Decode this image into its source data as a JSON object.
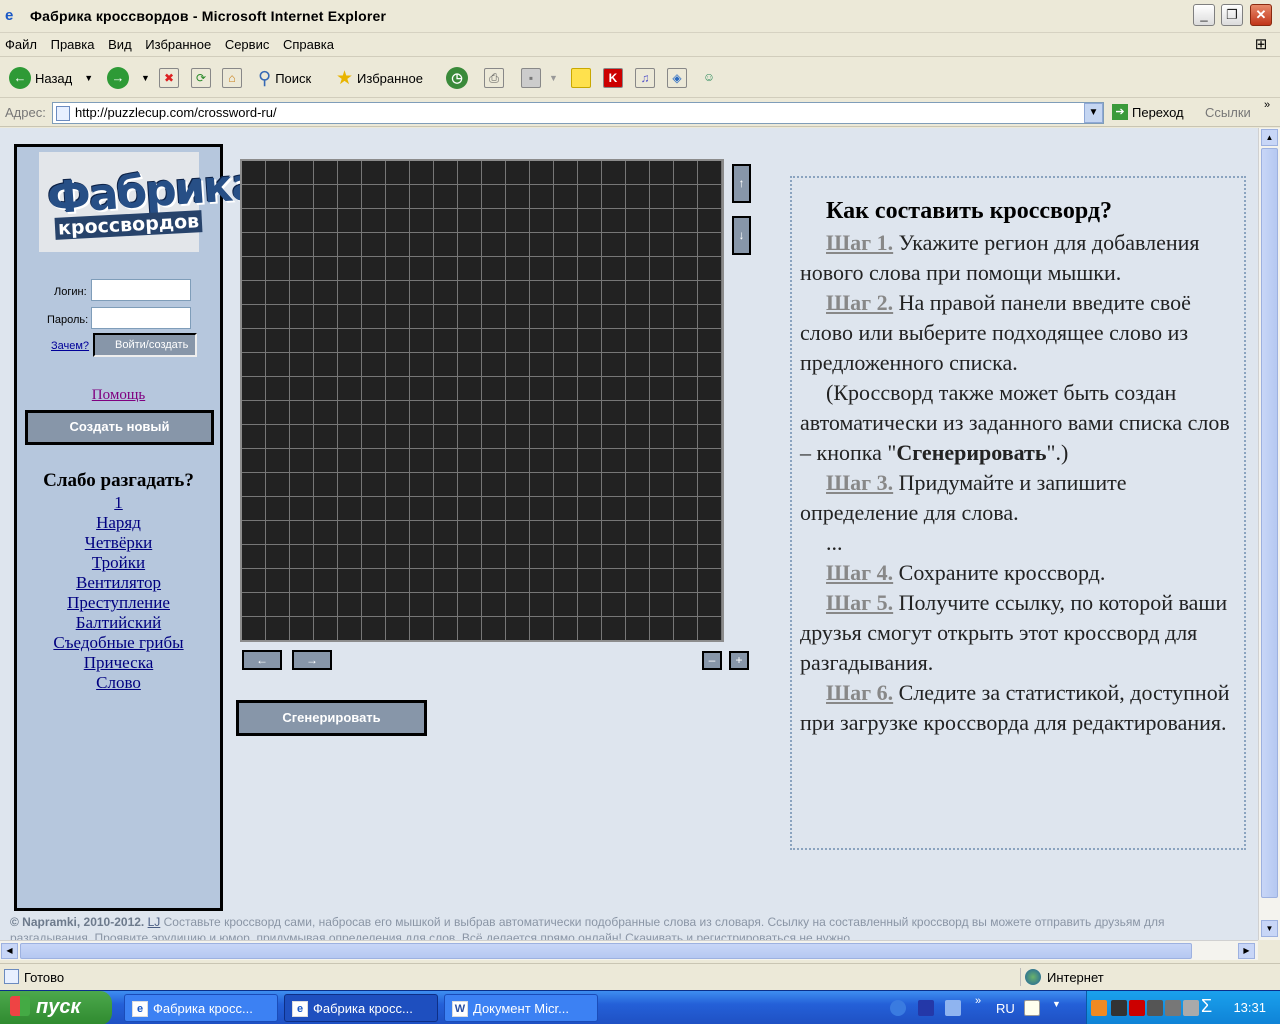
{
  "window": {
    "title": "Фабрика кроссвордов - Microsoft Internet Explorer"
  },
  "menu": [
    "Файл",
    "Правка",
    "Вид",
    "Избранное",
    "Сервис",
    "Справка"
  ],
  "toolbar": {
    "back": "Назад",
    "search": "Поиск",
    "favorites": "Избранное"
  },
  "address": {
    "label": "Адрес:",
    "url": "http://puzzlecup.com/crossword-ru/",
    "go": "Переход",
    "links": "Ссылки"
  },
  "sidebar": {
    "logo_big": "Фабрика",
    "logo_small": "кроссвордов",
    "login_label": "Логин:",
    "password_label": "Пароль:",
    "why_link": "Зачем?",
    "login_button": "Войти/создать",
    "help_link": "Помощь",
    "create_button": "Создать новый",
    "weak_title": "Слабо разгадать?",
    "puzzles": [
      "1",
      "Наряд",
      "Четвёрки",
      "Тройки",
      "Вентилятор",
      "Преступление",
      "Балтийский",
      "Съедобные грибы",
      "Прическа",
      "Слово"
    ]
  },
  "editor": {
    "up": "↑",
    "down": "↓",
    "left": "←",
    "right": "→",
    "minus": "–",
    "plus": "+",
    "generate_button": "Сгенерировать"
  },
  "instructions": {
    "title": "Как составить кроссворд?",
    "steps": [
      {
        "label": "Шаг 1.",
        "text": " Укажите регион для добавления нового слова при помощи мышки."
      },
      {
        "label": "Шаг 2.",
        "text": " На правой панели введите своё слово или выберите подходящее слово из предложенного списка."
      }
    ],
    "auto_pre": "(Кроссворд также может быть создан автоматически из заданного вами списка слов – кнопка \"",
    "auto_bold": "Сгенерировать",
    "auto_post": "\".)",
    "steps2": [
      {
        "label": "Шаг 3.",
        "text": " Придумайте и запишите определение для слова."
      }
    ],
    "ellipsis": "...",
    "steps3": [
      {
        "label": "Шаг 4.",
        "text": " Сохраните кроссворд."
      },
      {
        "label": "Шаг 5.",
        "text": " Получите ссылку, по которой ваши друзья смогут открыть этот кроссворд для разгадывания."
      },
      {
        "label": "Шаг 6.",
        "text": " Следите за статистикой, доступной при загрузке кроссворда для редактирования."
      }
    ]
  },
  "footer": {
    "copyright": "© Napramki, 2010-2012.",
    "lj": "LJ",
    "line1": " Составьте кроссворд сами, набросав его мышкой и выбрав автоматически подобранные слова из словаря. Ссылку на составленный кроссворд вы можете отправить друзьям для",
    "line2": "разгадывания. Проявите эрудицию и юмор, придумывая определения для слов. Всё делается прямо онлайн! Скачивать и регистрироваться не нужно."
  },
  "status": {
    "text": "Готово",
    "zone": "Интернет"
  },
  "taskbar": {
    "start": "пуск",
    "tasks": [
      "Фабрика кросс...",
      "Фабрика кросс...",
      "Документ Micr..."
    ],
    "lang": "RU",
    "clock": "13:31"
  },
  "colors": {
    "panel": "#B6C7DD",
    "page": "#DEE5EE",
    "button": "#8796a9",
    "grid": "#222222"
  }
}
